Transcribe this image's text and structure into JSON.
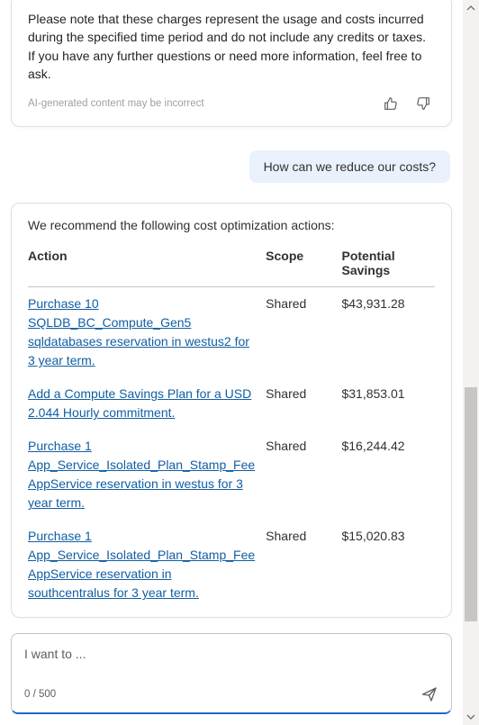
{
  "assistant_prev": {
    "text": "Please note that these charges represent the usage and costs incurred during the specified time period and do not include any credits or taxes. If you have any further questions or need more information, feel free to ask.",
    "disclaimer": "AI-generated content may be incorrect"
  },
  "user_message": "How can we reduce our costs?",
  "recommend": {
    "intro": "We recommend the following cost optimization actions:",
    "columns": {
      "action": "Action",
      "scope": "Scope",
      "savings": "Potential Savings"
    },
    "rows": [
      {
        "action": "Purchase 10 SQLDB_BC_Compute_Gen5 sqldatabases reservation in westus2 for 3 year term.",
        "scope": "Shared",
        "savings": "$43,931.28"
      },
      {
        "action": "Add a Compute Savings Plan for a USD 2.044 Hourly commitment.",
        "scope": "Shared",
        "savings": "$31,853.01"
      },
      {
        "action": "Purchase 1 App_Service_Isolated_Plan_Stamp_Fee AppService reservation in westus for 3 year term.",
        "scope": "Shared",
        "savings": "$16,244.42"
      },
      {
        "action": "Purchase 1 App_Service_Isolated_Plan_Stamp_Fee AppService reservation in southcentralus for 3 year term.",
        "scope": "Shared",
        "savings": "$15,020.83"
      }
    ]
  },
  "input": {
    "placeholder": "I want to ...",
    "char_count": "0 / 500"
  }
}
